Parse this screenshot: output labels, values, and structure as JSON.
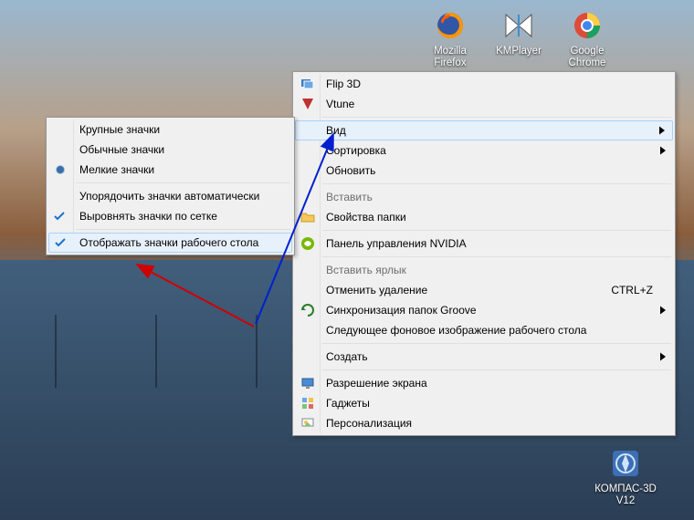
{
  "desktop_icons": [
    {
      "label": "Mozilla\nFirefox"
    },
    {
      "label": "KMPlayer"
    },
    {
      "label": "Google\nChrome"
    },
    {
      "label": "КОМПАС-3D\nV12"
    }
  ],
  "main_menu": {
    "flip3d": "Flip 3D",
    "vtune": "Vtune",
    "view": "Вид",
    "sort": "Сортировка",
    "refresh": "Обновить",
    "paste": "Вставить",
    "folder_props": "Свойства папки",
    "nvidia": "Панель управления NVIDIA",
    "paste_shortcut": "Вставить ярлык",
    "undo_delete": "Отменить удаление",
    "undo_shortcut": "CTRL+Z",
    "groove": "Синхронизация папок Groove",
    "next_wallpaper": "Следующее фоновое изображение рабочего стола",
    "create": "Создать",
    "resolution": "Разрешение экрана",
    "gadgets": "Гаджеты",
    "personalize": "Персонализация"
  },
  "view_submenu": {
    "large": "Крупные значки",
    "medium": "Обычные значки",
    "small": "Мелкие значки",
    "auto_arrange": "Упорядочить значки автоматически",
    "snap_grid": "Выровнять значки по сетке",
    "show_icons": "Отображать значки рабочего стола"
  }
}
